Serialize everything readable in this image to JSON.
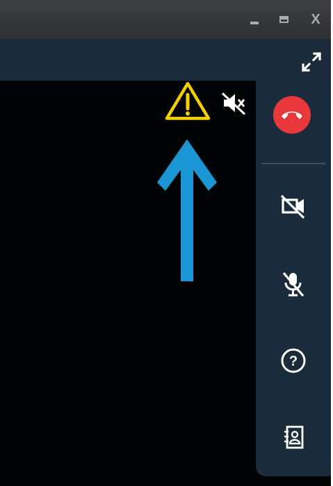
{
  "window": {
    "controls": [
      "minimize",
      "maximize",
      "close"
    ],
    "close_label": "X"
  },
  "toolbar": {
    "expand_icon": "expand-arrows-icon"
  },
  "video": {
    "warning_icon": "warning-triangle-icon",
    "speaker_icon": "speaker-muted-icon",
    "annotation": "arrow-up-icon"
  },
  "controls": {
    "hangup_icon": "phone-hangup-icon",
    "camera_icon": "camera-off-icon",
    "mic_icon": "mic-muted-icon",
    "help_label": "?",
    "contacts_icon": "contact-book-icon"
  },
  "colors": {
    "hangup": "#e8383b",
    "warning": "#f5d000",
    "arrow": "#1a96d4",
    "panel": "#1a2b3b"
  }
}
